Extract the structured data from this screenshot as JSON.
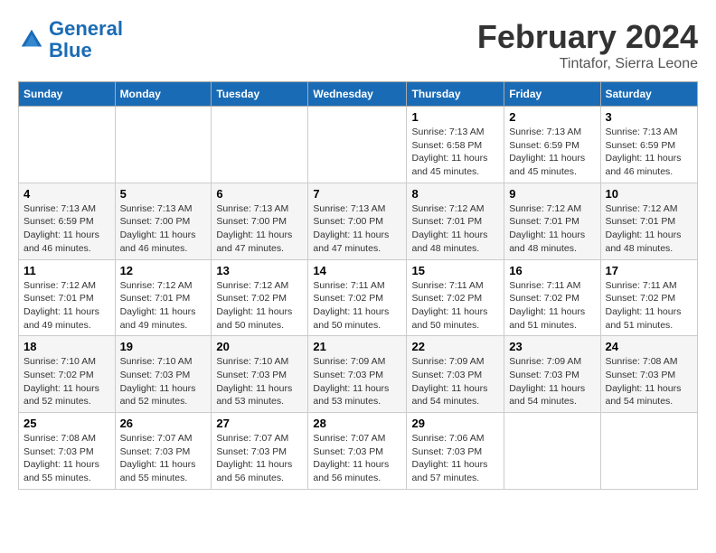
{
  "header": {
    "logo_line1": "General",
    "logo_line2": "Blue",
    "month": "February 2024",
    "location": "Tintafor, Sierra Leone"
  },
  "days_of_week": [
    "Sunday",
    "Monday",
    "Tuesday",
    "Wednesday",
    "Thursday",
    "Friday",
    "Saturday"
  ],
  "weeks": [
    [
      {
        "day": "",
        "info": ""
      },
      {
        "day": "",
        "info": ""
      },
      {
        "day": "",
        "info": ""
      },
      {
        "day": "",
        "info": ""
      },
      {
        "day": "1",
        "info": "Sunrise: 7:13 AM\nSunset: 6:58 PM\nDaylight: 11 hours\nand 45 minutes."
      },
      {
        "day": "2",
        "info": "Sunrise: 7:13 AM\nSunset: 6:59 PM\nDaylight: 11 hours\nand 45 minutes."
      },
      {
        "day": "3",
        "info": "Sunrise: 7:13 AM\nSunset: 6:59 PM\nDaylight: 11 hours\nand 46 minutes."
      }
    ],
    [
      {
        "day": "4",
        "info": "Sunrise: 7:13 AM\nSunset: 6:59 PM\nDaylight: 11 hours\nand 46 minutes."
      },
      {
        "day": "5",
        "info": "Sunrise: 7:13 AM\nSunset: 7:00 PM\nDaylight: 11 hours\nand 46 minutes."
      },
      {
        "day": "6",
        "info": "Sunrise: 7:13 AM\nSunset: 7:00 PM\nDaylight: 11 hours\nand 47 minutes."
      },
      {
        "day": "7",
        "info": "Sunrise: 7:13 AM\nSunset: 7:00 PM\nDaylight: 11 hours\nand 47 minutes."
      },
      {
        "day": "8",
        "info": "Sunrise: 7:12 AM\nSunset: 7:01 PM\nDaylight: 11 hours\nand 48 minutes."
      },
      {
        "day": "9",
        "info": "Sunrise: 7:12 AM\nSunset: 7:01 PM\nDaylight: 11 hours\nand 48 minutes."
      },
      {
        "day": "10",
        "info": "Sunrise: 7:12 AM\nSunset: 7:01 PM\nDaylight: 11 hours\nand 48 minutes."
      }
    ],
    [
      {
        "day": "11",
        "info": "Sunrise: 7:12 AM\nSunset: 7:01 PM\nDaylight: 11 hours\nand 49 minutes."
      },
      {
        "day": "12",
        "info": "Sunrise: 7:12 AM\nSunset: 7:01 PM\nDaylight: 11 hours\nand 49 minutes."
      },
      {
        "day": "13",
        "info": "Sunrise: 7:12 AM\nSunset: 7:02 PM\nDaylight: 11 hours\nand 50 minutes."
      },
      {
        "day": "14",
        "info": "Sunrise: 7:11 AM\nSunset: 7:02 PM\nDaylight: 11 hours\nand 50 minutes."
      },
      {
        "day": "15",
        "info": "Sunrise: 7:11 AM\nSunset: 7:02 PM\nDaylight: 11 hours\nand 50 minutes."
      },
      {
        "day": "16",
        "info": "Sunrise: 7:11 AM\nSunset: 7:02 PM\nDaylight: 11 hours\nand 51 minutes."
      },
      {
        "day": "17",
        "info": "Sunrise: 7:11 AM\nSunset: 7:02 PM\nDaylight: 11 hours\nand 51 minutes."
      }
    ],
    [
      {
        "day": "18",
        "info": "Sunrise: 7:10 AM\nSunset: 7:02 PM\nDaylight: 11 hours\nand 52 minutes."
      },
      {
        "day": "19",
        "info": "Sunrise: 7:10 AM\nSunset: 7:03 PM\nDaylight: 11 hours\nand 52 minutes."
      },
      {
        "day": "20",
        "info": "Sunrise: 7:10 AM\nSunset: 7:03 PM\nDaylight: 11 hours\nand 53 minutes."
      },
      {
        "day": "21",
        "info": "Sunrise: 7:09 AM\nSunset: 7:03 PM\nDaylight: 11 hours\nand 53 minutes."
      },
      {
        "day": "22",
        "info": "Sunrise: 7:09 AM\nSunset: 7:03 PM\nDaylight: 11 hours\nand 54 minutes."
      },
      {
        "day": "23",
        "info": "Sunrise: 7:09 AM\nSunset: 7:03 PM\nDaylight: 11 hours\nand 54 minutes."
      },
      {
        "day": "24",
        "info": "Sunrise: 7:08 AM\nSunset: 7:03 PM\nDaylight: 11 hours\nand 54 minutes."
      }
    ],
    [
      {
        "day": "25",
        "info": "Sunrise: 7:08 AM\nSunset: 7:03 PM\nDaylight: 11 hours\nand 55 minutes."
      },
      {
        "day": "26",
        "info": "Sunrise: 7:07 AM\nSunset: 7:03 PM\nDaylight: 11 hours\nand 55 minutes."
      },
      {
        "day": "27",
        "info": "Sunrise: 7:07 AM\nSunset: 7:03 PM\nDaylight: 11 hours\nand 56 minutes."
      },
      {
        "day": "28",
        "info": "Sunrise: 7:07 AM\nSunset: 7:03 PM\nDaylight: 11 hours\nand 56 minutes."
      },
      {
        "day": "29",
        "info": "Sunrise: 7:06 AM\nSunset: 7:03 PM\nDaylight: 11 hours\nand 57 minutes."
      },
      {
        "day": "",
        "info": ""
      },
      {
        "day": "",
        "info": ""
      }
    ]
  ]
}
